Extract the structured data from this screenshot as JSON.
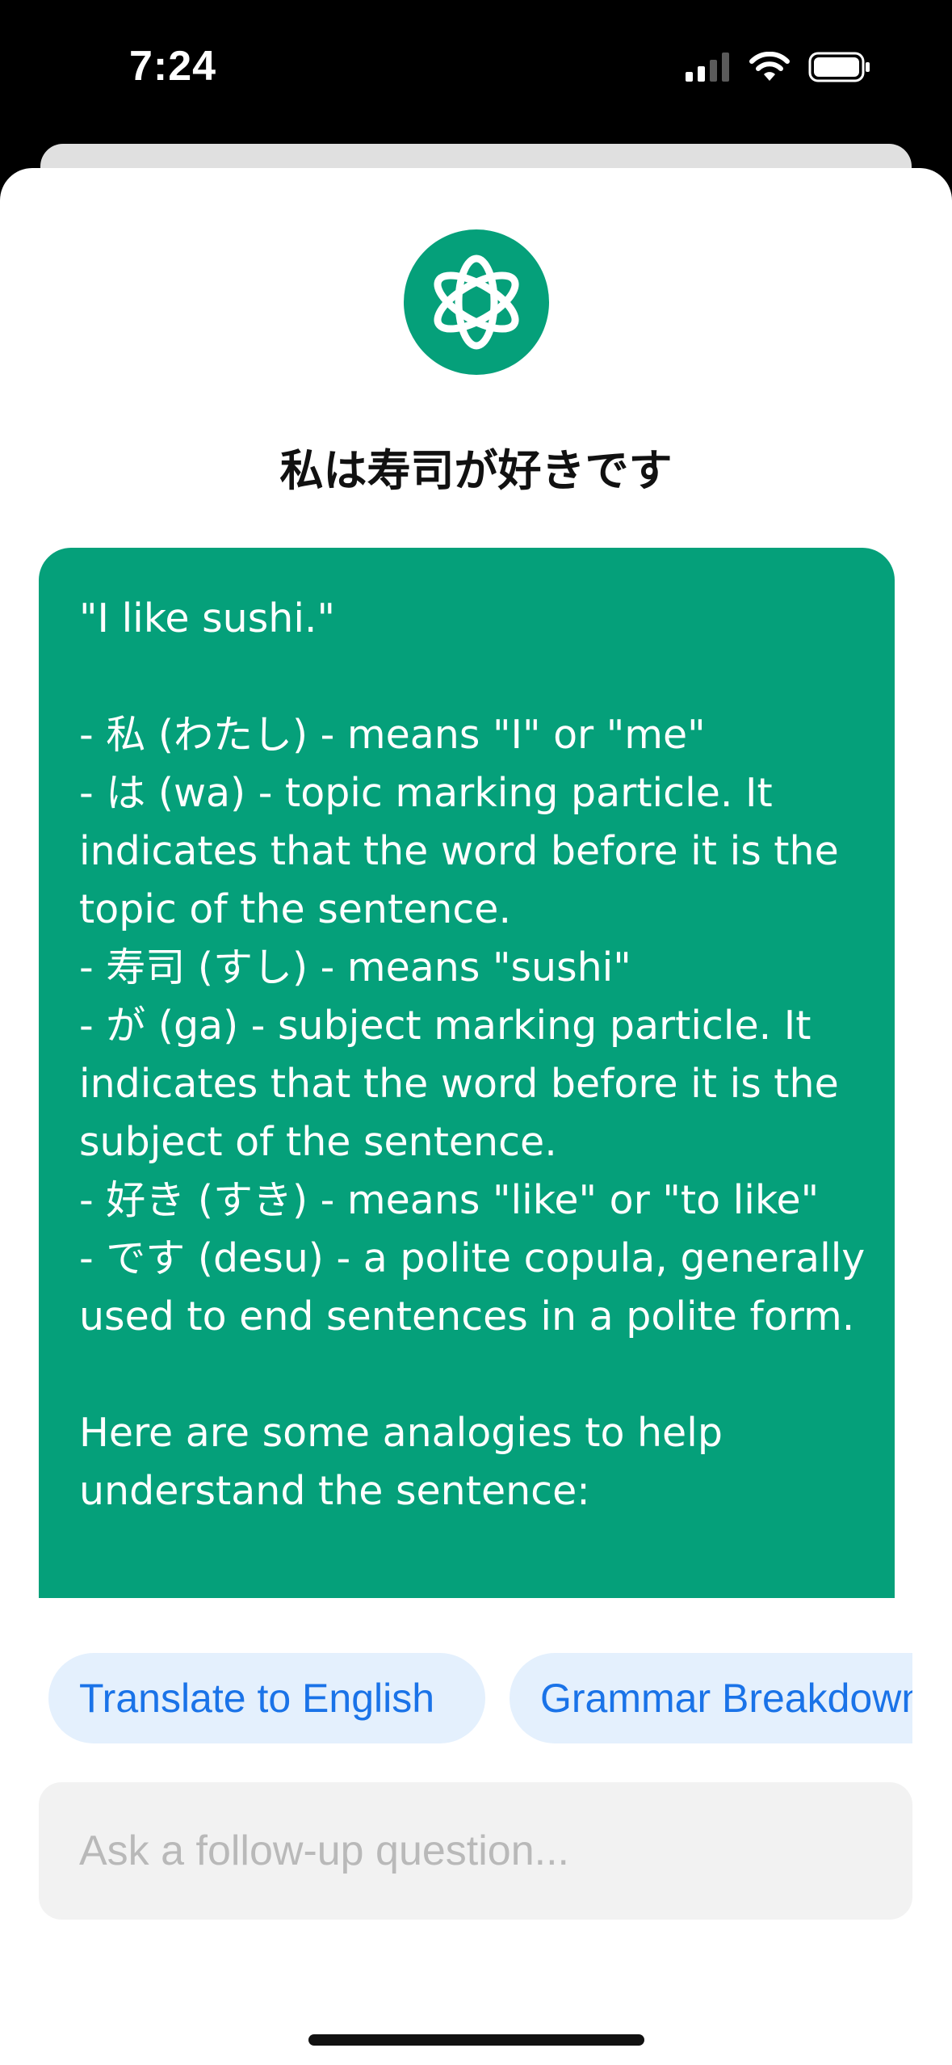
{
  "status_bar": {
    "time": "7:24",
    "icons": [
      "cellular-signal-icon",
      "wifi-icon",
      "battery-icon"
    ]
  },
  "header": {
    "logo_icon": "openai-logo-icon",
    "logo_color": "#05a07a",
    "title": "私は寿司が好きです"
  },
  "response": {
    "text": "\"I like sushi.\"\n\n- 私 (わたし) - means \"I\" or \"me\"\n- は (wa) - topic marking particle. It indicates that the word before it is the topic of the sentence.\n- 寿司 (すし) - means \"sushi\"\n- が (ga) - subject marking particle. It indicates that the word before it is the subject of the sentence.\n- 好き (すき) - means \"like\" or \"to like\"\n- です (desu) - a polite copula, generally used to end sentences in a polite form.\n\nHere are some analogies to help understand the sentence:"
  },
  "suggestions": [
    {
      "label": "Translate to English"
    },
    {
      "label": "Grammar Breakdown"
    }
  ],
  "composer": {
    "placeholder": "Ask a follow-up question..."
  }
}
